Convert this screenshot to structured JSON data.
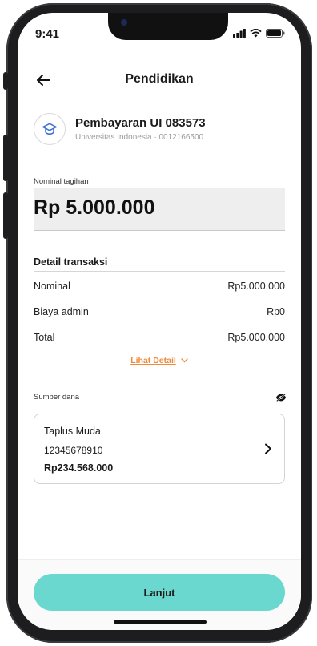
{
  "status_bar": {
    "time": "9:41"
  },
  "header": {
    "title": "Pendidikan"
  },
  "merchant": {
    "name": "Pembayaran UI 083573",
    "subtitle": "Universitas Indonesia · 0012166500"
  },
  "bill": {
    "label": "Nominal tagihan",
    "amount": "Rp 5.000.000"
  },
  "details": {
    "title": "Detail transaksi",
    "rows": [
      {
        "label": "Nominal",
        "value": "Rp5.000.000"
      },
      {
        "label": "Biaya admin",
        "value": "Rp0"
      },
      {
        "label": "Total",
        "value": "Rp5.000.000"
      }
    ],
    "link": "Lihat Detail"
  },
  "source": {
    "label": "Sumber dana",
    "account_name": "Taplus Muda",
    "account_number": "12345678910",
    "balance": "Rp234.568.000"
  },
  "cta": {
    "label": "Lanjut"
  },
  "colors": {
    "accent": "#6bd8cf",
    "link": "#f08a3c",
    "icon_blue": "#3b6fd8"
  }
}
